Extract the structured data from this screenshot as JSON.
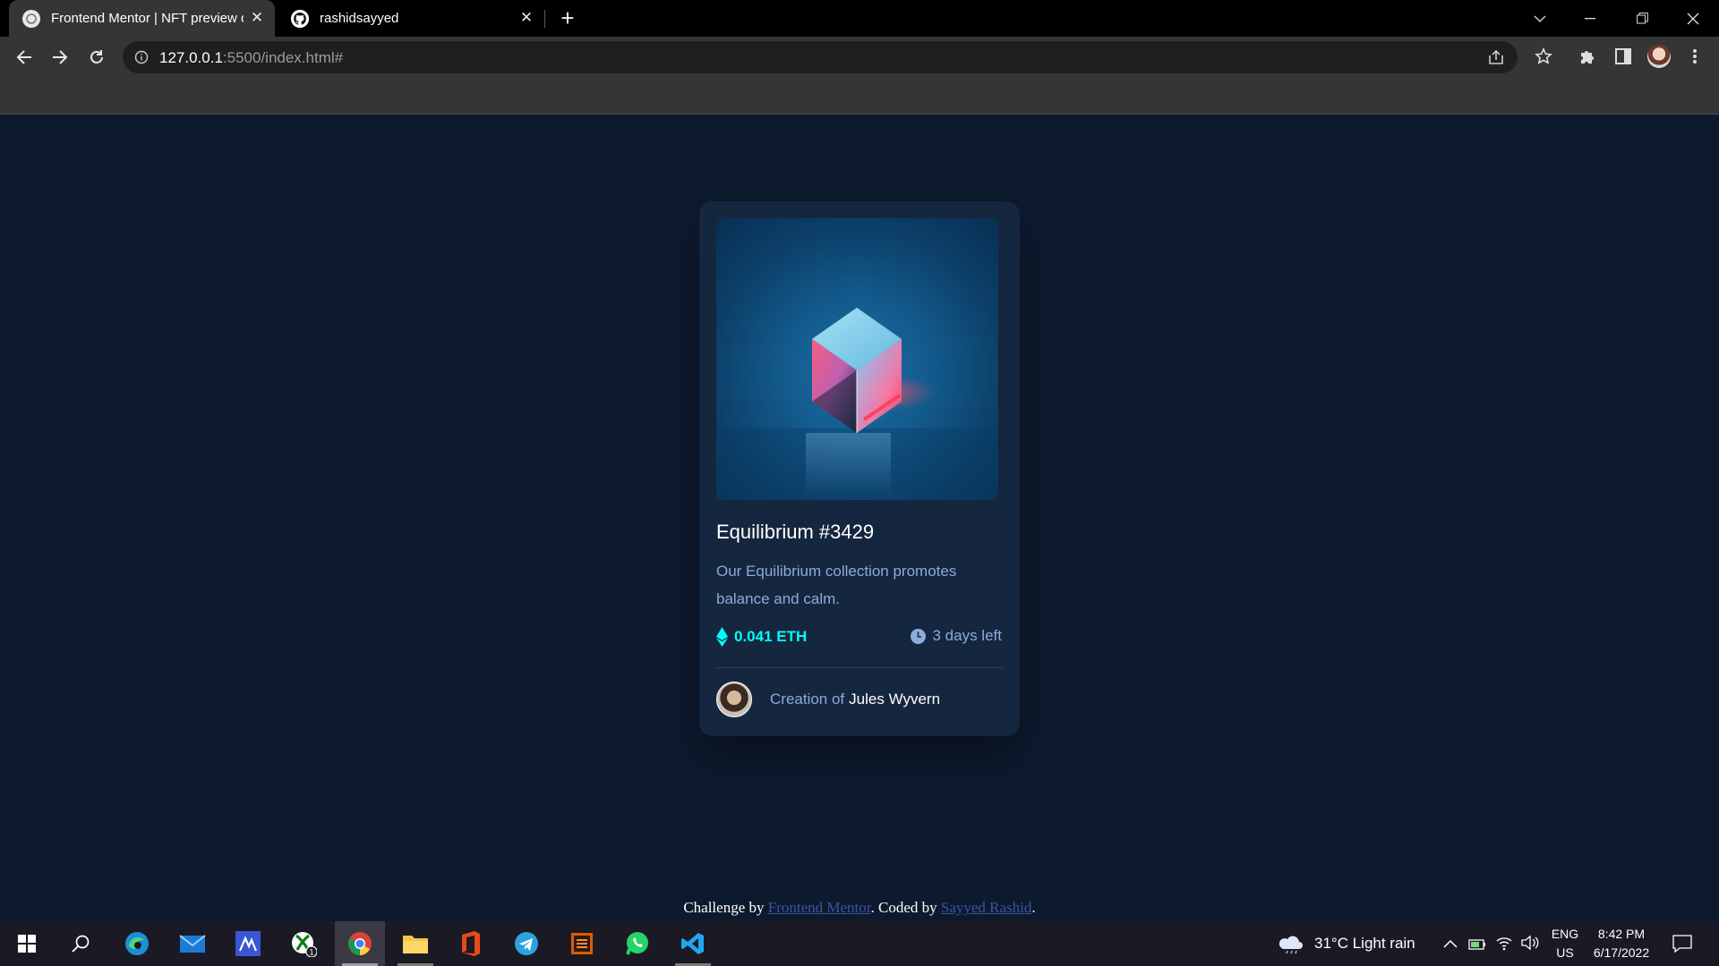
{
  "browser": {
    "tabs": [
      {
        "title": "Frontend Mentor | NFT preview c",
        "active": true,
        "favicon": "frontend-mentor-icon"
      },
      {
        "title": "rashidsayyed",
        "active": false,
        "favicon": "github-icon"
      }
    ],
    "address": {
      "host": "127.0.0.1",
      "path": ":5500/index.html#"
    }
  },
  "card": {
    "title": "Equilibrium #3429",
    "description": "Our Equilibrium collection promotes balance and calm.",
    "price": "0.041 ETH",
    "time_left": "3 days left",
    "creator_prefix": "Creation of",
    "creator_name": "Jules Wyvern",
    "colors": {
      "accent": "#00fff8",
      "muted": "#8bacd9",
      "card_bg": "#15263f",
      "page_bg": "#0d1a2e"
    }
  },
  "attribution": {
    "prefix": "Challenge by",
    "link1": "Frontend Mentor",
    "middle": ". Coded by",
    "link2": "Sayyed Rashid",
    "suffix": "."
  },
  "taskbar": {
    "apps": [
      "windows-start",
      "search",
      "edge",
      "mail",
      "app-m",
      "xbox",
      "chrome",
      "file-explorer",
      "office",
      "telegram",
      "sublime-text",
      "whatsapp",
      "vscode"
    ],
    "xbox_badge": "1",
    "weather": "31°C  Light rain",
    "language": "ENG",
    "region": "US",
    "time": "8:42 PM",
    "date": "6/17/2022"
  }
}
